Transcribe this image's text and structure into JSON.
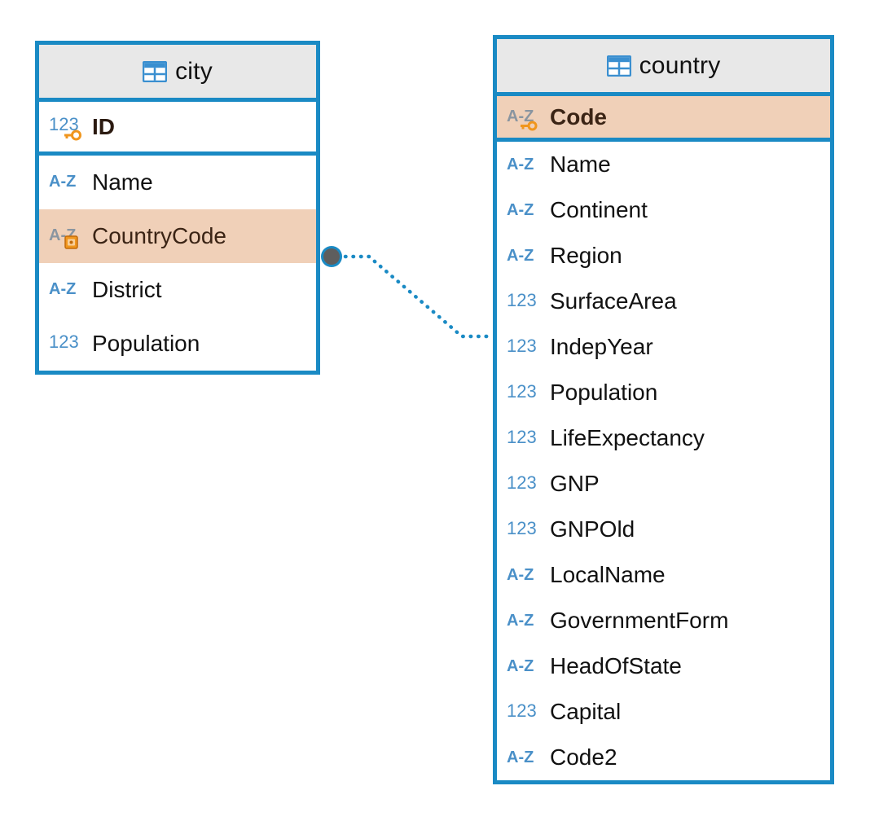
{
  "diagram": {
    "kind": "entity-relationship-diagram",
    "colors": {
      "table_border": "#1a8ac4",
      "header_background": "#e8e8e8",
      "highlight_row": "#f0d0b8",
      "type_icon_blue": "#5b9bd5",
      "key_orange": "#f0961e",
      "relation_dot": "#5e5e5e",
      "text": "#111111"
    }
  },
  "tables": [
    {
      "name": "city",
      "title": "city",
      "icon": "table-icon",
      "fields": [
        {
          "label": "ID",
          "type_icon": "numeric-123-icon",
          "bold": true,
          "highlight": false,
          "key": "primary-key-icon",
          "separator": true
        },
        {
          "label": "Name",
          "type_icon": "text-az-icon",
          "bold": false,
          "highlight": false,
          "key": null,
          "separator": false
        },
        {
          "label": "CountryCode",
          "type_icon": "text-az-icon",
          "bold": false,
          "highlight": true,
          "key": "foreign-key-icon",
          "separator": false
        },
        {
          "label": "District",
          "type_icon": "text-az-icon",
          "bold": false,
          "highlight": false,
          "key": null,
          "separator": false
        },
        {
          "label": "Population",
          "type_icon": "numeric-123-icon",
          "bold": false,
          "highlight": false,
          "key": null,
          "separator": false
        }
      ]
    },
    {
      "name": "country",
      "title": "country",
      "icon": "table-icon",
      "fields": [
        {
          "label": "Code",
          "type_icon": "text-az-icon",
          "bold": true,
          "highlight": true,
          "key": "primary-key-icon",
          "separator": true
        },
        {
          "label": "Name",
          "type_icon": "text-az-icon",
          "bold": false,
          "highlight": false,
          "key": null,
          "separator": false
        },
        {
          "label": "Continent",
          "type_icon": "text-az-icon",
          "bold": false,
          "highlight": false,
          "key": null,
          "separator": false
        },
        {
          "label": "Region",
          "type_icon": "text-az-icon",
          "bold": false,
          "highlight": false,
          "key": null,
          "separator": false
        },
        {
          "label": "SurfaceArea",
          "type_icon": "numeric-123-icon",
          "bold": false,
          "highlight": false,
          "key": null,
          "separator": false
        },
        {
          "label": "IndepYear",
          "type_icon": "numeric-123-icon",
          "bold": false,
          "highlight": false,
          "key": null,
          "separator": false
        },
        {
          "label": "Population",
          "type_icon": "numeric-123-icon",
          "bold": false,
          "highlight": false,
          "key": null,
          "separator": false
        },
        {
          "label": "LifeExpectancy",
          "type_icon": "numeric-123-icon",
          "bold": false,
          "highlight": false,
          "key": null,
          "separator": false
        },
        {
          "label": "GNP",
          "type_icon": "numeric-123-icon",
          "bold": false,
          "highlight": false,
          "key": null,
          "separator": false
        },
        {
          "label": "GNPOld",
          "type_icon": "numeric-123-icon",
          "bold": false,
          "highlight": false,
          "key": null,
          "separator": false
        },
        {
          "label": "LocalName",
          "type_icon": "text-az-icon",
          "bold": false,
          "highlight": false,
          "key": null,
          "separator": false
        },
        {
          "label": "GovernmentForm",
          "type_icon": "text-az-icon",
          "bold": false,
          "highlight": false,
          "key": null,
          "separator": false
        },
        {
          "label": "HeadOfState",
          "type_icon": "text-az-icon",
          "bold": false,
          "highlight": false,
          "key": null,
          "separator": false
        },
        {
          "label": "Capital",
          "type_icon": "numeric-123-icon",
          "bold": false,
          "highlight": false,
          "key": null,
          "separator": false
        },
        {
          "label": "Code2",
          "type_icon": "text-az-icon",
          "bold": false,
          "highlight": false,
          "key": null,
          "separator": false
        }
      ]
    }
  ],
  "relationship": {
    "name": "city-countrycode-to-country-code",
    "from_table": "city",
    "from_field": "CountryCode",
    "to_table": "country",
    "to_field": "Code",
    "style": "dotted"
  }
}
